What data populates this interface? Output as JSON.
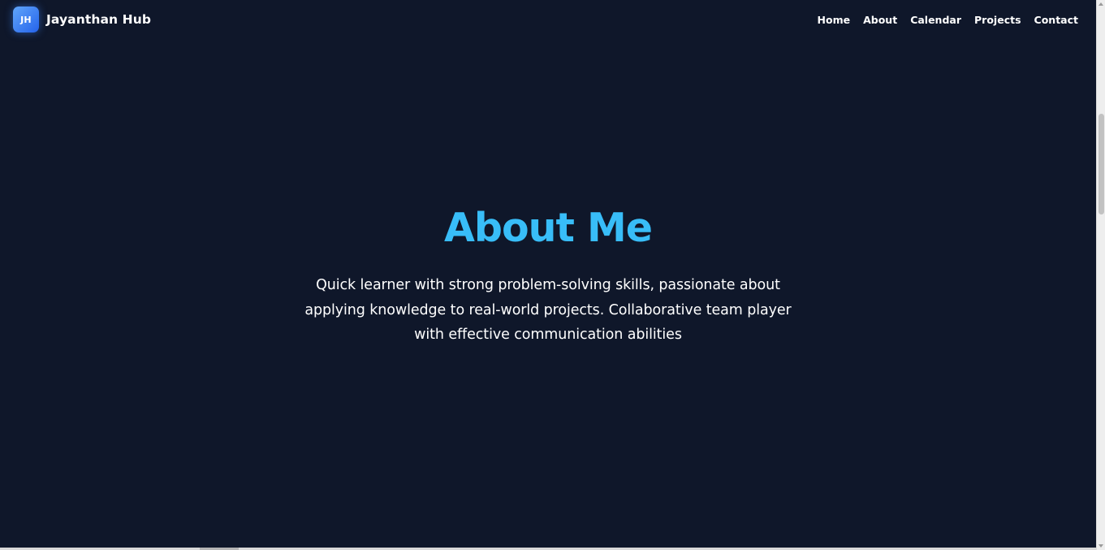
{
  "brand": {
    "logo_initials": "JH",
    "name": "Jayanthan Hub"
  },
  "nav": {
    "items": [
      {
        "label": "Home"
      },
      {
        "label": "About"
      },
      {
        "label": "Calendar"
      },
      {
        "label": "Projects"
      },
      {
        "label": "Contact"
      }
    ]
  },
  "hero": {
    "title": "About Me",
    "description": "Quick learner with strong problem-solving skills, passionate about applying knowledge to real-world projects. Collaborative team player with effective communication abilities"
  },
  "scroll": {
    "vertical_position_fraction": 0.2,
    "horizontal_position_fraction": 0.18
  },
  "colors": {
    "background": "#0f172a",
    "accent": "#38bdf8",
    "logo_gradient_start": "#60a5fa",
    "logo_gradient_end": "#2563eb",
    "text": "#ffffff"
  },
  "icons": {
    "logo": "jh-badge-icon",
    "scroll_up": "scroll-up-arrow-icon",
    "scroll_down": "scroll-down-arrow-icon"
  }
}
